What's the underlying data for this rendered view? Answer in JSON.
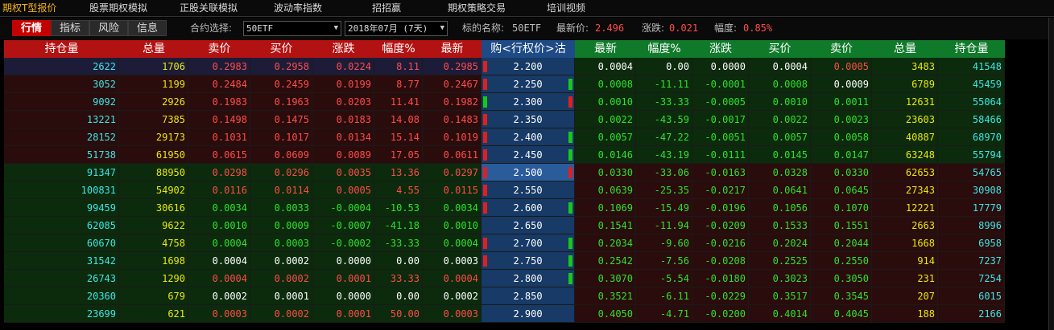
{
  "menu": [
    {
      "label": "期权T型报价",
      "active": true
    },
    {
      "label": "股票期权模拟",
      "active": false
    },
    {
      "label": "正股关联模拟",
      "active": false
    },
    {
      "label": "波动率指数",
      "active": false
    },
    {
      "label": "招招赢",
      "active": false
    },
    {
      "label": "期权策略交易",
      "active": false
    },
    {
      "label": "培训视频",
      "active": false
    }
  ],
  "toolbar": {
    "tabs": [
      {
        "label": "行情",
        "active": true
      },
      {
        "label": "指标",
        "active": false
      },
      {
        "label": "风险",
        "active": false
      },
      {
        "label": "信息",
        "active": false
      }
    ],
    "contract_label": "合约选择:",
    "contract_value": "50ETF",
    "month_value": "2018年07月 (7天)",
    "underlying_label": "标的名称:",
    "underlying_value": "50ETF",
    "last_label": "最新价:",
    "last_value": "2.496",
    "change_label": "涨跌:",
    "change_value": "0.021",
    "pct_label": "幅度:",
    "pct_value": "0.85%"
  },
  "colors": {
    "call_header": "#b31212",
    "put_header": "#0f7a2a",
    "strike_bg": "#173a66",
    "up": "#ff4b4b",
    "down": "#2fe02f"
  },
  "headers": {
    "call": [
      "持仓量",
      "总量",
      "卖价",
      "买价",
      "涨跌",
      "幅度%",
      "最新"
    ],
    "strike": "购<行权价>沽",
    "put": [
      "最新",
      "幅度%",
      "涨跌",
      "买价",
      "卖价",
      "总量",
      "持仓量"
    ]
  },
  "rows": [
    {
      "call": [
        "2622",
        "1706",
        "0.2983",
        "0.2958",
        "0.0224",
        "8.11",
        "0.2985"
      ],
      "strike": "2.200",
      "put": [
        "0.0004",
        "0.00",
        "0.0000",
        "0.0004",
        "0.0005",
        "3483",
        "41548"
      ],
      "cind": "red",
      "pind": "none"
    },
    {
      "call": [
        "3052",
        "1199",
        "0.2484",
        "0.2459",
        "0.0199",
        "8.77",
        "0.2467"
      ],
      "strike": "2.250",
      "put": [
        "0.0008",
        "-11.11",
        "-0.0001",
        "0.0008",
        "0.0009",
        "6789",
        "45459"
      ],
      "cind": "red",
      "pind": "green"
    },
    {
      "call": [
        "9092",
        "2926",
        "0.1983",
        "0.1963",
        "0.0203",
        "11.41",
        "0.1982"
      ],
      "strike": "2.300",
      "put": [
        "0.0010",
        "-33.33",
        "-0.0005",
        "0.0010",
        "0.0011",
        "12631",
        "55064"
      ],
      "cind": "green",
      "pind": "red"
    },
    {
      "call": [
        "13221",
        "7385",
        "0.1498",
        "0.1475",
        "0.0183",
        "14.08",
        "0.1483"
      ],
      "strike": "2.350",
      "put": [
        "0.0022",
        "-43.59",
        "-0.0017",
        "0.0022",
        "0.0023",
        "23603",
        "58466"
      ],
      "cind": "red",
      "pind": "none"
    },
    {
      "call": [
        "28152",
        "29173",
        "0.1031",
        "0.1017",
        "0.0134",
        "15.14",
        "0.1019"
      ],
      "strike": "2.400",
      "put": [
        "0.0057",
        "-47.22",
        "-0.0051",
        "0.0057",
        "0.0058",
        "40887",
        "68970"
      ],
      "cind": "red",
      "pind": "green"
    },
    {
      "call": [
        "51738",
        "61950",
        "0.0615",
        "0.0609",
        "0.0089",
        "17.05",
        "0.0611"
      ],
      "strike": "2.450",
      "put": [
        "0.0146",
        "-43.19",
        "-0.0111",
        "0.0145",
        "0.0147",
        "63248",
        "55794"
      ],
      "cind": "red",
      "pind": "green"
    },
    {
      "call": [
        "91347",
        "88950",
        "0.0298",
        "0.0296",
        "0.0035",
        "13.36",
        "0.0297"
      ],
      "strike": "2.500",
      "put": [
        "0.0330",
        "-33.06",
        "-0.0163",
        "0.0328",
        "0.0330",
        "62653",
        "54765"
      ],
      "cind": "red",
      "pind": "red"
    },
    {
      "call": [
        "100831",
        "54902",
        "0.0116",
        "0.0114",
        "0.0005",
        "4.55",
        "0.0115"
      ],
      "strike": "2.550",
      "put": [
        "0.0639",
        "-25.35",
        "-0.0217",
        "0.0641",
        "0.0645",
        "27343",
        "30908"
      ],
      "cind": "red",
      "pind": "none"
    },
    {
      "call": [
        "99459",
        "30616",
        "0.0034",
        "0.0033",
        "-0.0004",
        "-10.53",
        "0.0034"
      ],
      "strike": "2.600",
      "put": [
        "0.1069",
        "-15.49",
        "-0.0196",
        "0.1056",
        "0.1070",
        "12221",
        "17779"
      ],
      "cind": "red",
      "pind": "green"
    },
    {
      "call": [
        "62085",
        "9622",
        "0.0010",
        "0.0009",
        "-0.0007",
        "-41.18",
        "0.0010"
      ],
      "strike": "2.650",
      "put": [
        "0.1541",
        "-11.94",
        "-0.0209",
        "0.1533",
        "0.1551",
        "2663",
        "8996"
      ],
      "cind": "none",
      "pind": "none"
    },
    {
      "call": [
        "60670",
        "4758",
        "0.0004",
        "0.0003",
        "-0.0002",
        "-33.33",
        "0.0004"
      ],
      "strike": "2.700",
      "put": [
        "0.2034",
        "-9.60",
        "-0.0216",
        "0.2024",
        "0.2044",
        "1668",
        "6958"
      ],
      "cind": "red",
      "pind": "green"
    },
    {
      "call": [
        "31542",
        "1698",
        "0.0004",
        "0.0002",
        "0.0000",
        "0.00",
        "0.0003"
      ],
      "strike": "2.750",
      "put": [
        "0.2542",
        "-7.56",
        "-0.0208",
        "0.2525",
        "0.2550",
        "914",
        "7237"
      ],
      "cind": "red",
      "pind": "green"
    },
    {
      "call": [
        "26743",
        "1290",
        "0.0004",
        "0.0002",
        "0.0001",
        "33.33",
        "0.0004"
      ],
      "strike": "2.800",
      "put": [
        "0.3070",
        "-5.54",
        "-0.0180",
        "0.3023",
        "0.3050",
        "231",
        "7254"
      ],
      "cind": "none",
      "pind": "green"
    },
    {
      "call": [
        "20360",
        "679",
        "0.0002",
        "0.0001",
        "0.0000",
        "0.00",
        "0.0002"
      ],
      "strike": "2.850",
      "put": [
        "0.3521",
        "-6.11",
        "-0.0229",
        "0.3517",
        "0.3545",
        "207",
        "6015"
      ],
      "cind": "none",
      "pind": "none"
    },
    {
      "call": [
        "23699",
        "621",
        "0.0003",
        "0.0002",
        "0.0001",
        "50.00",
        "0.0003"
      ],
      "strike": "2.900",
      "put": [
        "0.4050",
        "-4.71",
        "-0.0200",
        "0.4014",
        "0.4045",
        "188",
        "2166"
      ],
      "cind": "none",
      "pind": "none"
    }
  ],
  "call_row_bg": [
    "#1c1c38",
    "#2a0c0c",
    "#2a0c0c",
    "#2a0c0c",
    "#2a0c0c",
    "#2a0c0c",
    "#0c2a0c",
    "#0c2a0c",
    "#0c2a0c",
    "#0c2a0c",
    "#0c2a0c",
    "#0c2a0c",
    "#0c2a0c",
    "#0c2a0c",
    "#0c2a0c"
  ],
  "put_row_bg": [
    "#0c2a0c",
    "#0c2a0c",
    "#0c2a0c",
    "#0c2a0c",
    "#0c2a0c",
    "#0c2a0c",
    "#2a0c0c",
    "#2a0c0c",
    "#2a0c0c",
    "#2a0c0c",
    "#2a0c0c",
    "#2a0c0c",
    "#2a0c0c",
    "#2a0c0c",
    "#2a0c0c"
  ],
  "selected_strike": "2.500"
}
